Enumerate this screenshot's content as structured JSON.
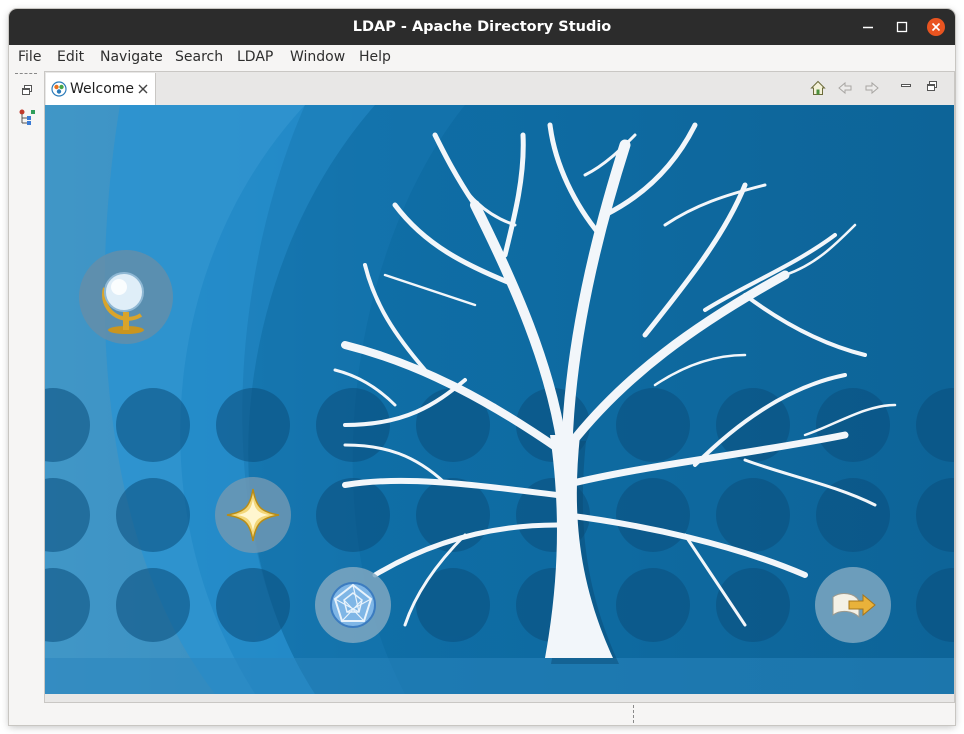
{
  "window": {
    "title": "LDAP - Apache Directory Studio",
    "controls": [
      "minimize",
      "maximize",
      "close"
    ],
    "close_color": "#e95420"
  },
  "menubar": {
    "items": [
      "File",
      "Edit",
      "Navigate",
      "Search",
      "LDAP",
      "Window",
      "Help"
    ]
  },
  "left_toolbar": {
    "items": [
      "restore-icon",
      "ldap-browser-perspective-icon"
    ]
  },
  "editor": {
    "tab": {
      "label": "Welcome",
      "icon": "welcome-icon"
    },
    "toolbar": [
      "home-icon",
      "back-icon",
      "forward-icon",
      "minimize-icon",
      "restore-icon"
    ]
  },
  "welcome": {
    "background_color": "#0e6fa3",
    "links": [
      "overview-globe",
      "tutorials-star",
      "whats-new-web",
      "workbench-arrow"
    ]
  }
}
